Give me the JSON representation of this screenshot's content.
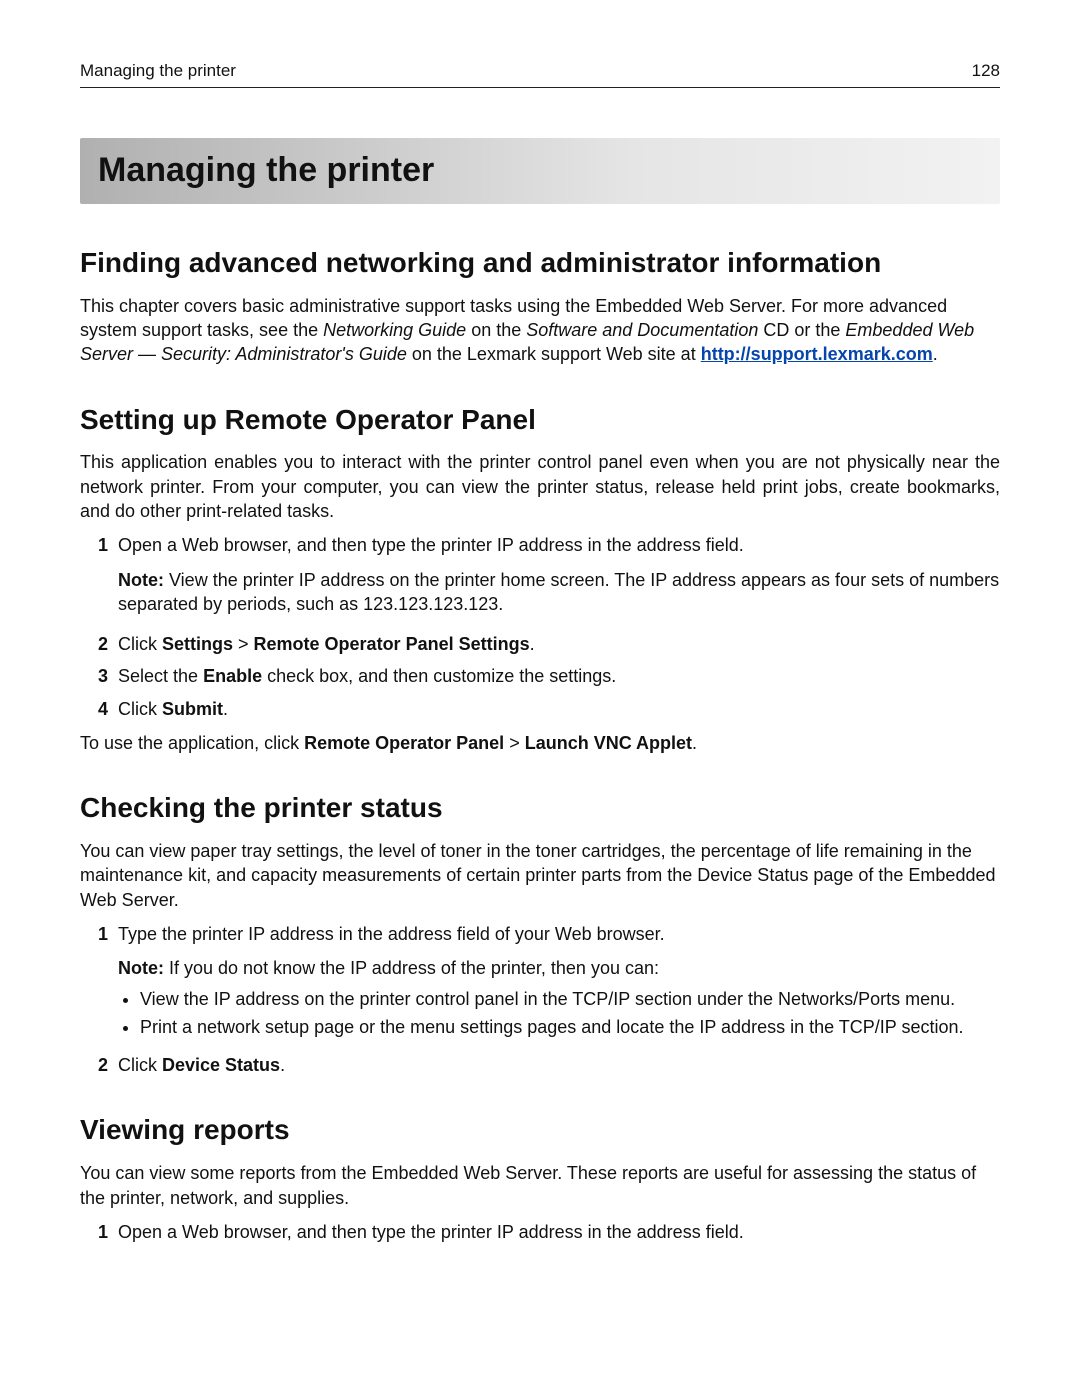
{
  "header": {
    "left": "Managing the printer",
    "page_number": "128"
  },
  "title": "Managing the printer",
  "s1": {
    "heading": "Finding advanced networking and administrator information",
    "p1a": "This chapter covers basic administrative support tasks using the Embedded Web Server. For more advanced system support tasks, see the ",
    "p1b": "Networking Guide",
    "p1c": " on the ",
    "p1d": "Software and Documentation",
    "p1e": " CD or the ",
    "p1f": "Embedded Web Server — Security: Administrator's Guide",
    "p1g": " on the Lexmark support Web site at ",
    "link": "http://support.lexmark.com",
    "p1h": "."
  },
  "s2": {
    "heading": "Setting up Remote Operator Panel",
    "intro": "This application enables you to interact with the printer control panel even when you are not physically near the network printer. From your computer, you can view the printer status, release held print jobs, create bookmarks, and do other print-related tasks.",
    "step1": "Open a Web browser, and then type the printer IP address in the address field.",
    "note1_label": "Note:",
    "note1": " View the printer IP address on the printer home screen. The IP address appears as four sets of numbers separated by periods, such as 123.123.123.123.",
    "step2a": "Click ",
    "step2b": "Settings",
    "step2c": " > ",
    "step2d": "Remote Operator Panel Settings",
    "step2e": ".",
    "step3a": "Select the ",
    "step3b": "Enable",
    "step3c": " check box, and then customize the settings.",
    "step4a": "Click ",
    "step4b": "Submit",
    "step4c": ".",
    "outro_a": "To use the application, click ",
    "outro_b": "Remote Operator Panel",
    "outro_c": " > ",
    "outro_d": "Launch VNC Applet",
    "outro_e": "."
  },
  "s3": {
    "heading": "Checking the printer status",
    "intro": "You can view paper tray settings, the level of toner in the toner cartridges, the percentage of life remaining in the maintenance kit, and capacity measurements of certain printer parts from the Device Status page of the Embedded Web Server.",
    "step1": "Type the printer IP address in the address field of your Web browser.",
    "note1_label": "Note:",
    "note1": " If you do not know the IP address of the printer, then you can:",
    "bullet1": "View the IP address on the printer control panel in the TCP/IP section under the Networks/Ports menu.",
    "bullet2": "Print a network setup page or the menu settings pages and locate the IP address in the TCP/IP section.",
    "step2a": "Click ",
    "step2b": "Device Status",
    "step2c": "."
  },
  "s4": {
    "heading": "Viewing reports",
    "intro": "You can view some reports from the Embedded Web Server. These reports are useful for assessing the status of the printer, network, and supplies.",
    "step1": "Open a Web browser, and then type the printer IP address in the address field."
  },
  "nums": {
    "n1": "1",
    "n2": "2",
    "n3": "3",
    "n4": "4"
  }
}
